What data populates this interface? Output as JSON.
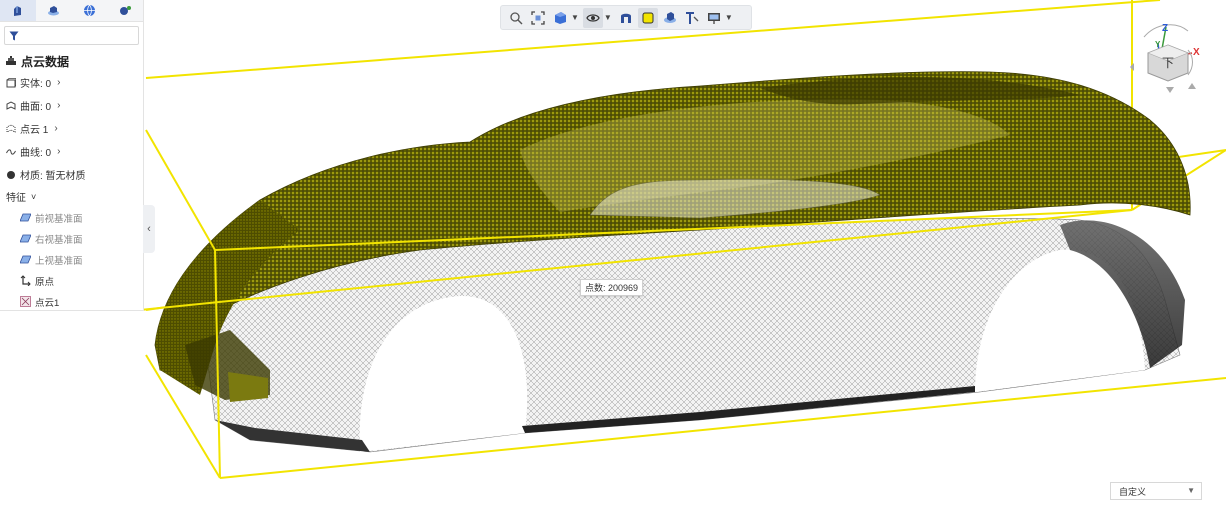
{
  "panel": {
    "tabs": [
      {
        "icon": "part-tree-icon"
      },
      {
        "icon": "assembly-icon"
      },
      {
        "icon": "globe-icon"
      },
      {
        "icon": "sensor-icon"
      }
    ],
    "filter_placeholder": "",
    "root_label": "点云数据",
    "items": [
      {
        "label": "实体: 0"
      },
      {
        "label": "曲面: 0"
      },
      {
        "label": "点云 1"
      },
      {
        "label": "曲线: 0"
      }
    ],
    "material_label": "材质: 暂无材质",
    "features_label": "特征",
    "features": [
      {
        "label": "前视基准面"
      },
      {
        "label": "右视基准面"
      },
      {
        "label": "上视基准面"
      },
      {
        "label": "原点"
      },
      {
        "label": "点云1"
      }
    ]
  },
  "viewport": {
    "point_count_tooltip": "点数: 200969",
    "view_cube_face": "下",
    "axis_z": "Z",
    "axis_x": "X",
    "axis_y": "Y",
    "view_mode": "自定义",
    "bbox_color": "#f2e400",
    "pointcloud_color": "#6b6a00"
  },
  "toolbar": {
    "buttons": [
      "zoom-icon",
      "fit-view-icon",
      "cube-view-icon",
      "eye-icon",
      "section-icon",
      "display-mode-icon",
      "render-icon",
      "text-icon",
      "monitor-icon"
    ]
  }
}
